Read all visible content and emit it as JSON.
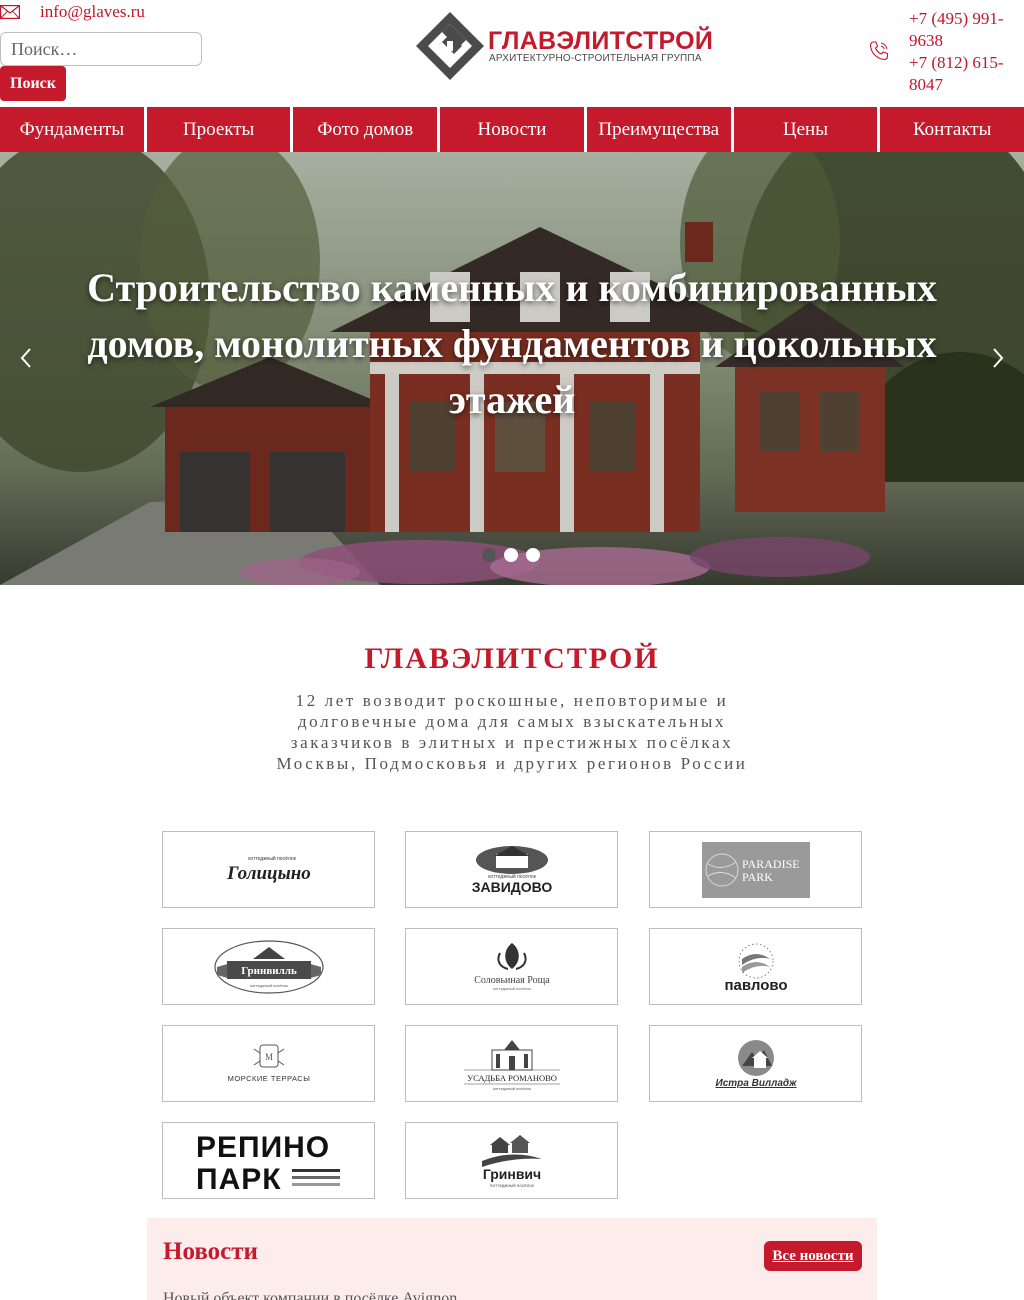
{
  "header": {
    "email": "info@glaves.ru",
    "search": {
      "placeholder": "Поиск…",
      "button_label": "Поиск"
    },
    "logo": {
      "title": "ГЛАВЭЛИТСТРОЙ",
      "subtitle": "АРХИТЕКТУРНО-СТРОИТЕЛЬНАЯ ГРУППА"
    },
    "phones": [
      "+7 (495) 991-9638",
      "+7 (812) 615-8047"
    ]
  },
  "nav": {
    "items": [
      {
        "label": "Фундаменты"
      },
      {
        "label": "Проекты"
      },
      {
        "label": "Фото домов"
      },
      {
        "label": "Новости"
      },
      {
        "label": "Преимущества"
      },
      {
        "label": "Цены"
      },
      {
        "label": "Контакты"
      }
    ]
  },
  "hero": {
    "title": "Строительство каменных и комбинированных домов, монолитных фундаментов и цокольных этажей",
    "slides_count": 3,
    "active_slide": 1
  },
  "about": {
    "title": "ГЛАВЭЛИТСТРОЙ",
    "text": "12 лет возводит роскошные, неповторимые и долговечные дома для самых взыскательных заказчиков в элитных и престижных посёлках Москвы, Подмосковья и других регионов России"
  },
  "partners": {
    "items": [
      {
        "name": "Голицыно",
        "caption": "коттеджный посёлок"
      },
      {
        "name": "ЗАВИДОВО",
        "caption": "коттеджный посёлок"
      },
      {
        "name": "PARADISE PARK",
        "line1": "PARADISE",
        "line2": "PARK"
      },
      {
        "name": "Гринвилль",
        "caption": "коттеджный посёлок"
      },
      {
        "name": "Соловьиная Роща",
        "caption": "коттеджный посёлок"
      },
      {
        "name": "павлово"
      },
      {
        "name": "МОРСКИЕ ТЕРРАСЫ"
      },
      {
        "name": "УСАДЬБА РОМАНОВО",
        "caption": "коттеджный посёлок"
      },
      {
        "name": "Истра Вилладж"
      },
      {
        "name": "РЕПИНО ПАРК",
        "line1": "РЕПИНО",
        "line2": "ПАРК"
      },
      {
        "name": "Гринвич",
        "caption": "Коттеджный посёлок"
      }
    ]
  },
  "news": {
    "title": "Новости",
    "all_label": "Все новости",
    "first_item": "Новый объект компании в посёлке Avignon"
  },
  "colors": {
    "accent": "#c41a2c",
    "news_bg": "#fcecec"
  },
  "icons": {
    "email": "envelope-icon",
    "phone": "phone-icon",
    "prev": "chevron-left-icon",
    "next": "chevron-right-icon"
  }
}
